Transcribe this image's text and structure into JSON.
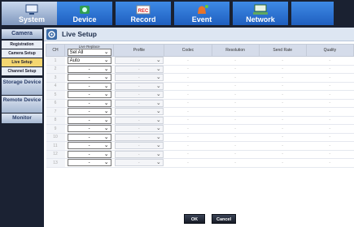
{
  "nav": {
    "tabs": [
      {
        "label": "System",
        "icon": "monitor-icon"
      },
      {
        "label": "Device",
        "icon": "camera-icon"
      },
      {
        "label": "Record",
        "icon": "record-icon"
      },
      {
        "label": "Event",
        "icon": "bell-icon"
      },
      {
        "label": "Network",
        "icon": "network-icon"
      }
    ]
  },
  "sidebar": {
    "camera": "Camera",
    "items": [
      "Registration",
      "Camera Setup",
      "Live Setup",
      "Channel Setup"
    ],
    "storage": "Storage Device",
    "remote": "Remote Device",
    "monitor": "Monitor"
  },
  "page": {
    "title": "Live Setup"
  },
  "table": {
    "headers": {
      "ch": "CH",
      "live_replace": "Live Replace",
      "profile": "Profile",
      "codec": "Codec",
      "resolution": "Resolution",
      "send_rate": "Send Rate",
      "quality": "Quality"
    },
    "sel_all": "Sel All",
    "rows": [
      {
        "ch": "1",
        "value": "Auto"
      },
      {
        "ch": "2",
        "value": "-"
      },
      {
        "ch": "3",
        "value": "-"
      },
      {
        "ch": "4",
        "value": "-"
      },
      {
        "ch": "5",
        "value": "-"
      },
      {
        "ch": "6",
        "value": "-"
      },
      {
        "ch": "7",
        "value": "-"
      },
      {
        "ch": "8",
        "value": "-"
      },
      {
        "ch": "9",
        "value": "-"
      },
      {
        "ch": "10",
        "value": "-"
      },
      {
        "ch": "11",
        "value": "-"
      },
      {
        "ch": "12",
        "value": "-"
      },
      {
        "ch": "13",
        "value": "-"
      }
    ],
    "dash": "-"
  },
  "buttons": {
    "ok": "OK",
    "cancel": "Cancel"
  }
}
